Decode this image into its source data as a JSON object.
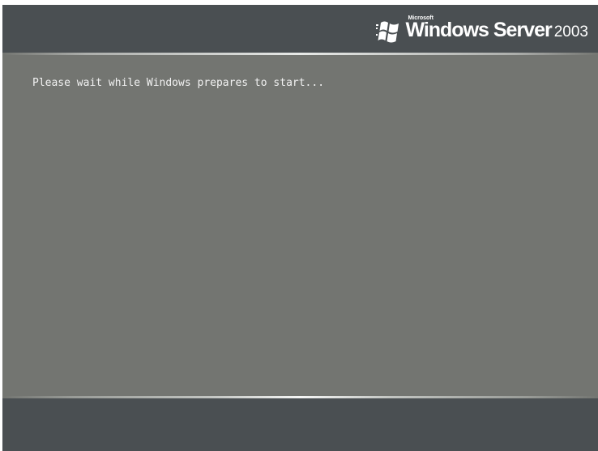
{
  "logo": {
    "brand": "Microsoft",
    "product": "Windows Server",
    "version": "2003"
  },
  "status": {
    "message": "Please wait while Windows prepares to start..."
  },
  "colors": {
    "background": "#737571",
    "bars": "#4a4f52",
    "text": "#f2f2f2"
  },
  "icons": {
    "logo_icon": "windows-flag-icon"
  }
}
